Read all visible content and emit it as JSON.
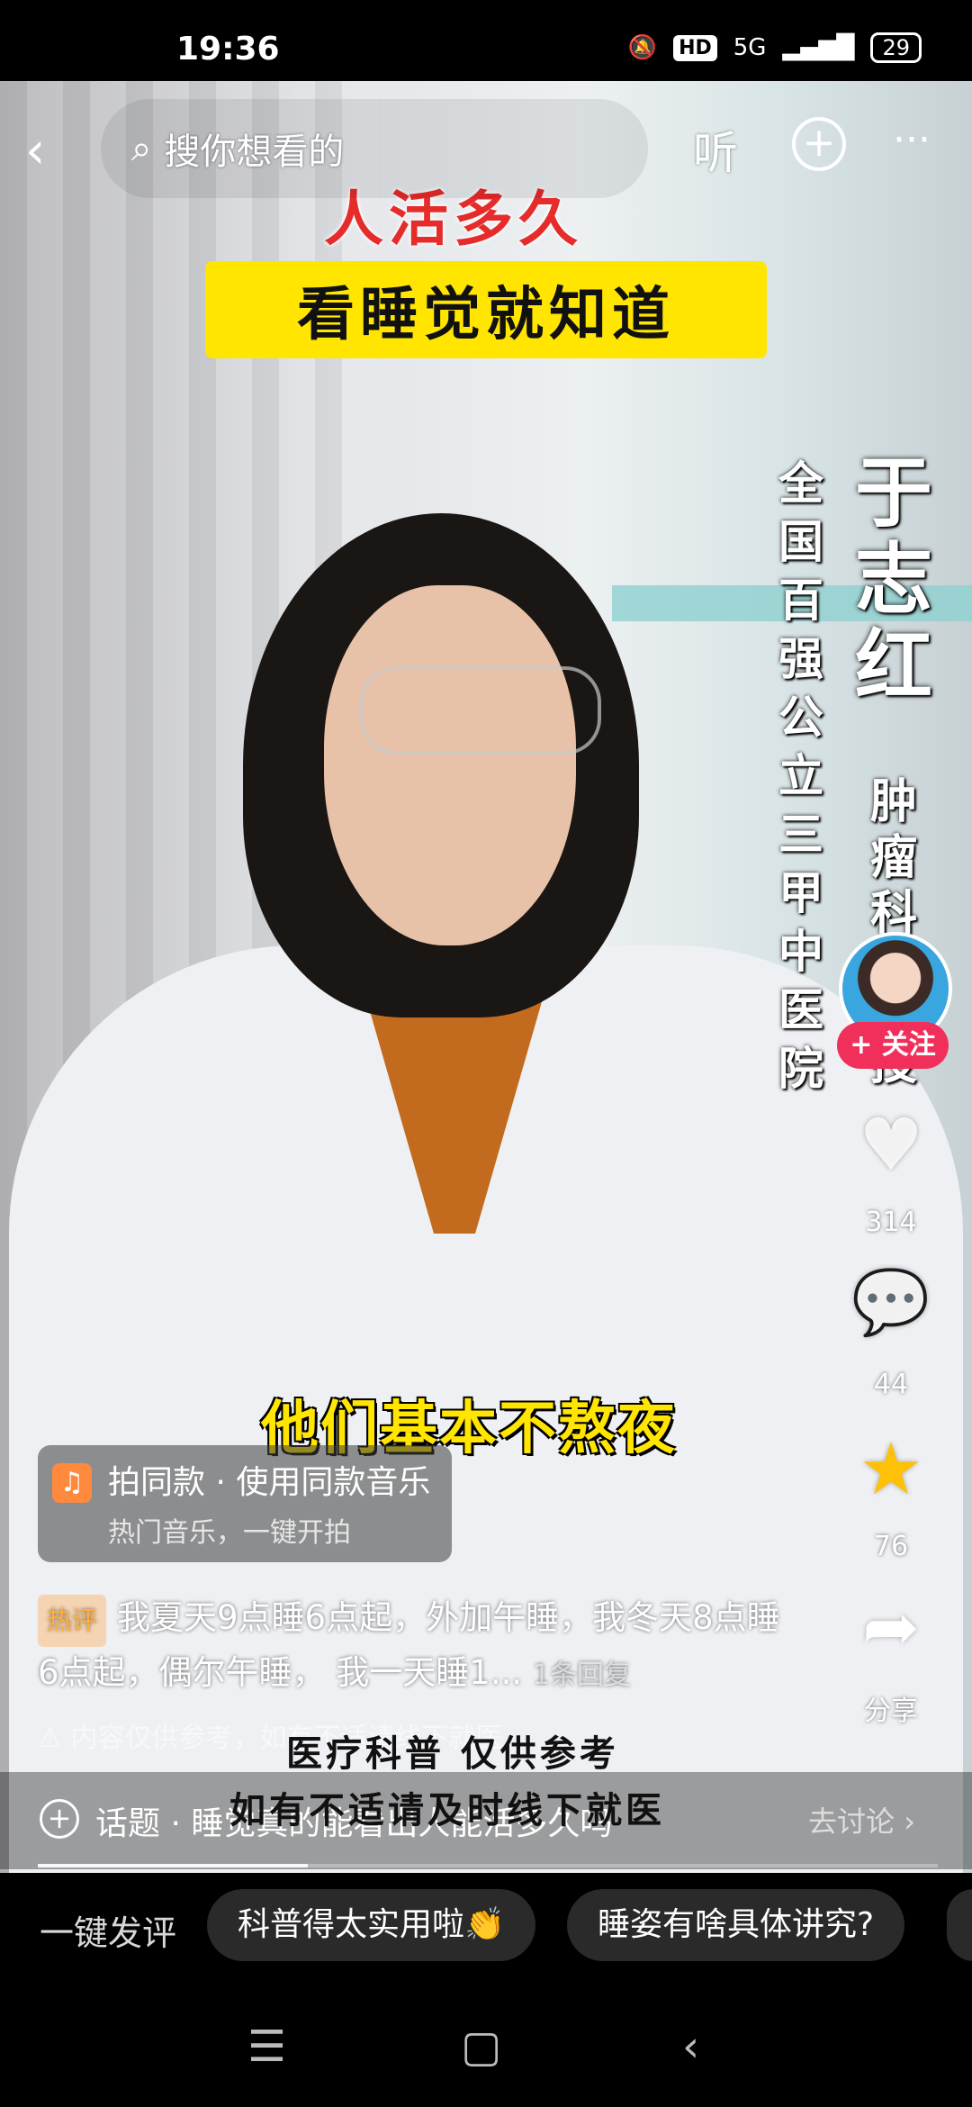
{
  "status_bar": {
    "time": "19:36",
    "hd": "HD",
    "network": "5G",
    "battery": "29"
  },
  "top_bar": {
    "search_placeholder": "搜你想看的",
    "listen_label": "听"
  },
  "video": {
    "title_line1": "人活多久",
    "title_line2": "看睡觉就知道",
    "name_vertical": "于志红",
    "dept_vertical": "肿瘤科",
    "dept_extra": "授",
    "hospital_vertical": "全国百强公立三甲中医院",
    "subtitle": "他们基本不熬夜",
    "disclaimer_line1": "医疗科普 仅供参考",
    "disclaimer_line2": "如有不适请及时线下就医"
  },
  "actions": {
    "follow_label": "+ 关注",
    "likes": "314",
    "comments": "44",
    "favorites": "76",
    "share_label": "分享"
  },
  "music": {
    "title": "拍同款 · 使用同款音乐",
    "subtitle": "热门音乐，一键开拍"
  },
  "hot_comment": {
    "tag": "热评",
    "text": "我夏天9点睡6点起，外加午睡，我冬天8点睡6点起，偶尔午睡， 我一天睡1...",
    "replies": "1条回复"
  },
  "notice": "内容仅供参考，如有不适请线下就医",
  "topic": {
    "text": "话题 · 睡觉真的能看出人能活多久吗",
    "action": "去讨论"
  },
  "playback": {
    "progress_fraction": 0.3
  },
  "quick_comment": {
    "label": "一键发评",
    "chips": [
      "科普得太实用啦👏",
      "睡姿有啥具体讲究?"
    ]
  },
  "colors": {
    "title_red": "#e62b2b",
    "banner_yellow": "#ffe500",
    "follow_pink": "#f0305a",
    "star_gold": "#ffc107"
  },
  "icons": [
    "back-arrow-icon",
    "search-icon",
    "add-icon",
    "more-icon",
    "heart-icon",
    "comment-icon",
    "star-icon",
    "share-icon",
    "music-note-icon",
    "warning-icon",
    "topic-plus-icon",
    "chevron-right-icon",
    "menu-icon",
    "home-square-icon",
    "back-nav-icon"
  ]
}
